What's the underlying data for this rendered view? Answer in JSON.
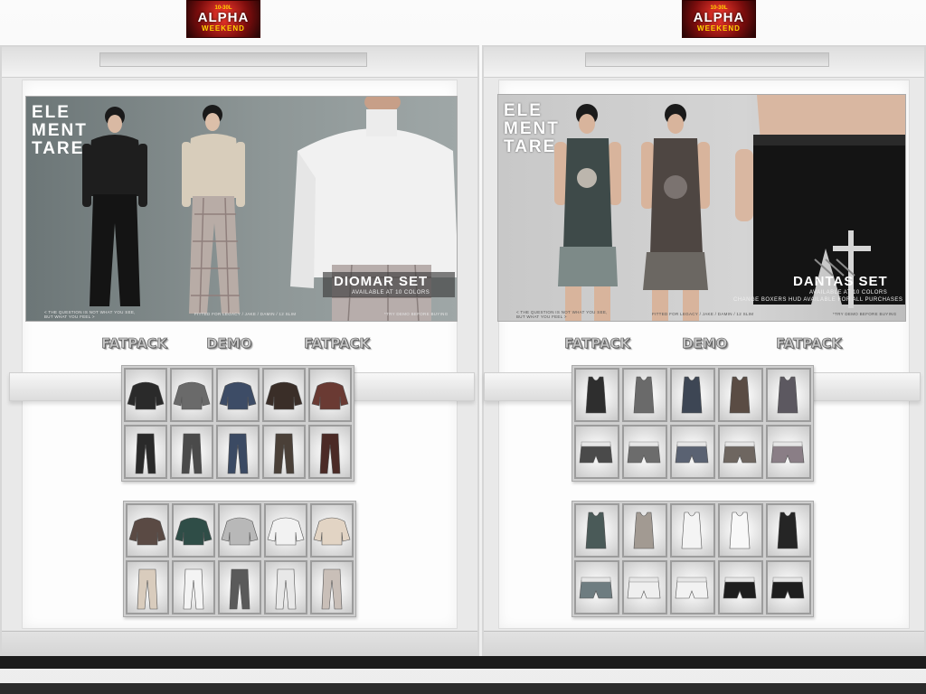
{
  "signs": {
    "year": "10-30L",
    "line1": "ALPHA",
    "line2": "WEEKEND"
  },
  "left_poster": {
    "brand": [
      "ELE",
      "MENT",
      "TARE"
    ],
    "title": "DIOMAR SET",
    "subtitle": "AVAILABLE AT 10 COLORS",
    "fine_left": [
      "< THE QUESTION IS NOT WHAT YOU SEE,",
      "BUT WHAT YOU FEEL >"
    ],
    "fine_mid": "FITTED FOR LEGACY / JAKE / DAMIN / 12 SLIM",
    "fine_right": "*TRY DEMO BEFORE BUYING"
  },
  "right_poster": {
    "brand": [
      "ELE",
      "MENT",
      "TARE"
    ],
    "title": "DANTAS SET",
    "subtitle": "AVAILABLE AT 10 COLORS",
    "subtitle2": "CHANGE BOXERS HUD AVAILABLE FOR ALL PURCHASES",
    "fine_left": [
      "< THE QUESTION IS NOT WHAT YOU SEE,",
      "BUT WHAT YOU FEEL >"
    ],
    "fine_mid": "FITTED FOR LEGACY / JAKE / DAMIN / 12 SLIM",
    "fine_right": "*TRY DEMO BEFORE BUYING"
  },
  "vendor_labels": {
    "left": [
      "FATPACK",
      "DEMO",
      "FATPACK"
    ],
    "right": [
      "FATPACK",
      "DEMO",
      "FATPACK"
    ]
  },
  "swatches": {
    "left_jackets_1": [
      "#2a2a2a",
      "#6a6a6a",
      "#3d4c66",
      "#3a2e28",
      "#6a3a33"
    ],
    "left_pants_1": [
      "#2a2a2a",
      "#4a4a4a",
      "#3b4a63",
      "#4a4038",
      "#4b2a26"
    ],
    "left_jackets_2": [
      "#5a4a44",
      "#2f4d47",
      "#b8b8b8",
      "#f2f2f2",
      "#e2d4c4"
    ],
    "left_pants_2": [
      "#d9ccbd",
      "#f4f4f4",
      "#5a5a5a",
      "#e8e8e8",
      "#c9bfb8"
    ],
    "right_tanks_1": [
      "#2e2e2e",
      "#6a6a6a",
      "#3d4654",
      "#5a4c44",
      "#5c5860"
    ],
    "right_shorts_1": [
      "#4a4a4a",
      "#6c6c6c",
      "#5a6272",
      "#6e6660",
      "#8a7e86"
    ],
    "right_tanks_2": [
      "#4a5a58",
      "#a29a92",
      "#f4f4f4",
      "#f8f8f8",
      "#252525"
    ],
    "right_shorts_2": [
      "#6e7c80",
      "#efefef",
      "#f2f2f2",
      "#1e1e1e",
      "#1e1e1e"
    ]
  }
}
